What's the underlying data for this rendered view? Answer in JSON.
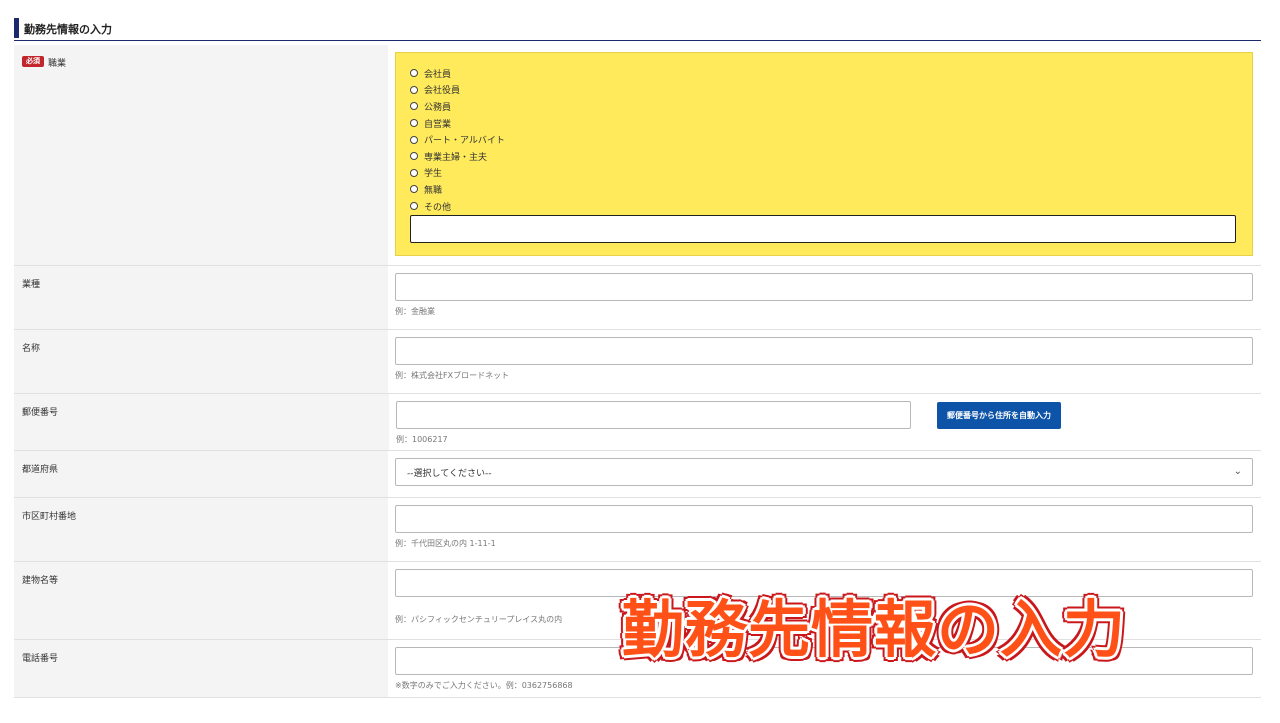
{
  "section": {
    "title": "勤務先情報の入力"
  },
  "occupation": {
    "badge": "必須",
    "label": "職業",
    "options": [
      "会社員",
      "会社役員",
      "公務員",
      "自営業",
      "パート・アルバイト",
      "専業主婦・主夫",
      "学生",
      "無職",
      "その他"
    ],
    "other_value": ""
  },
  "industry": {
    "label": "業種",
    "value": "",
    "hint": "例：金融業"
  },
  "company_name": {
    "label": "名称",
    "value": "",
    "hint": "例：株式会社FXブロードネット"
  },
  "postal_code": {
    "label": "郵便番号",
    "value": "",
    "hint": "例：1006217",
    "button_label": "郵便番号から住所を自動入力"
  },
  "prefecture": {
    "label": "都道府県",
    "selected": "--選択してください--"
  },
  "address": {
    "label": "市区町村番地",
    "value": "",
    "hint": "例：千代田区丸の内 1-11-1"
  },
  "building": {
    "label": "建物名等",
    "value": "",
    "hint": "例：パシフィックセンチュリープレイス丸の内"
  },
  "phone": {
    "label": "電話番号",
    "value": "",
    "hint": "※数字のみでご入力ください。例：0362756868"
  },
  "overlay": {
    "caption": "勤務先情報の入力"
  },
  "colors": {
    "accent": "#1c2a6b",
    "highlight": "#ffea5c",
    "button": "#0d54a8",
    "required": "#c0262b"
  }
}
